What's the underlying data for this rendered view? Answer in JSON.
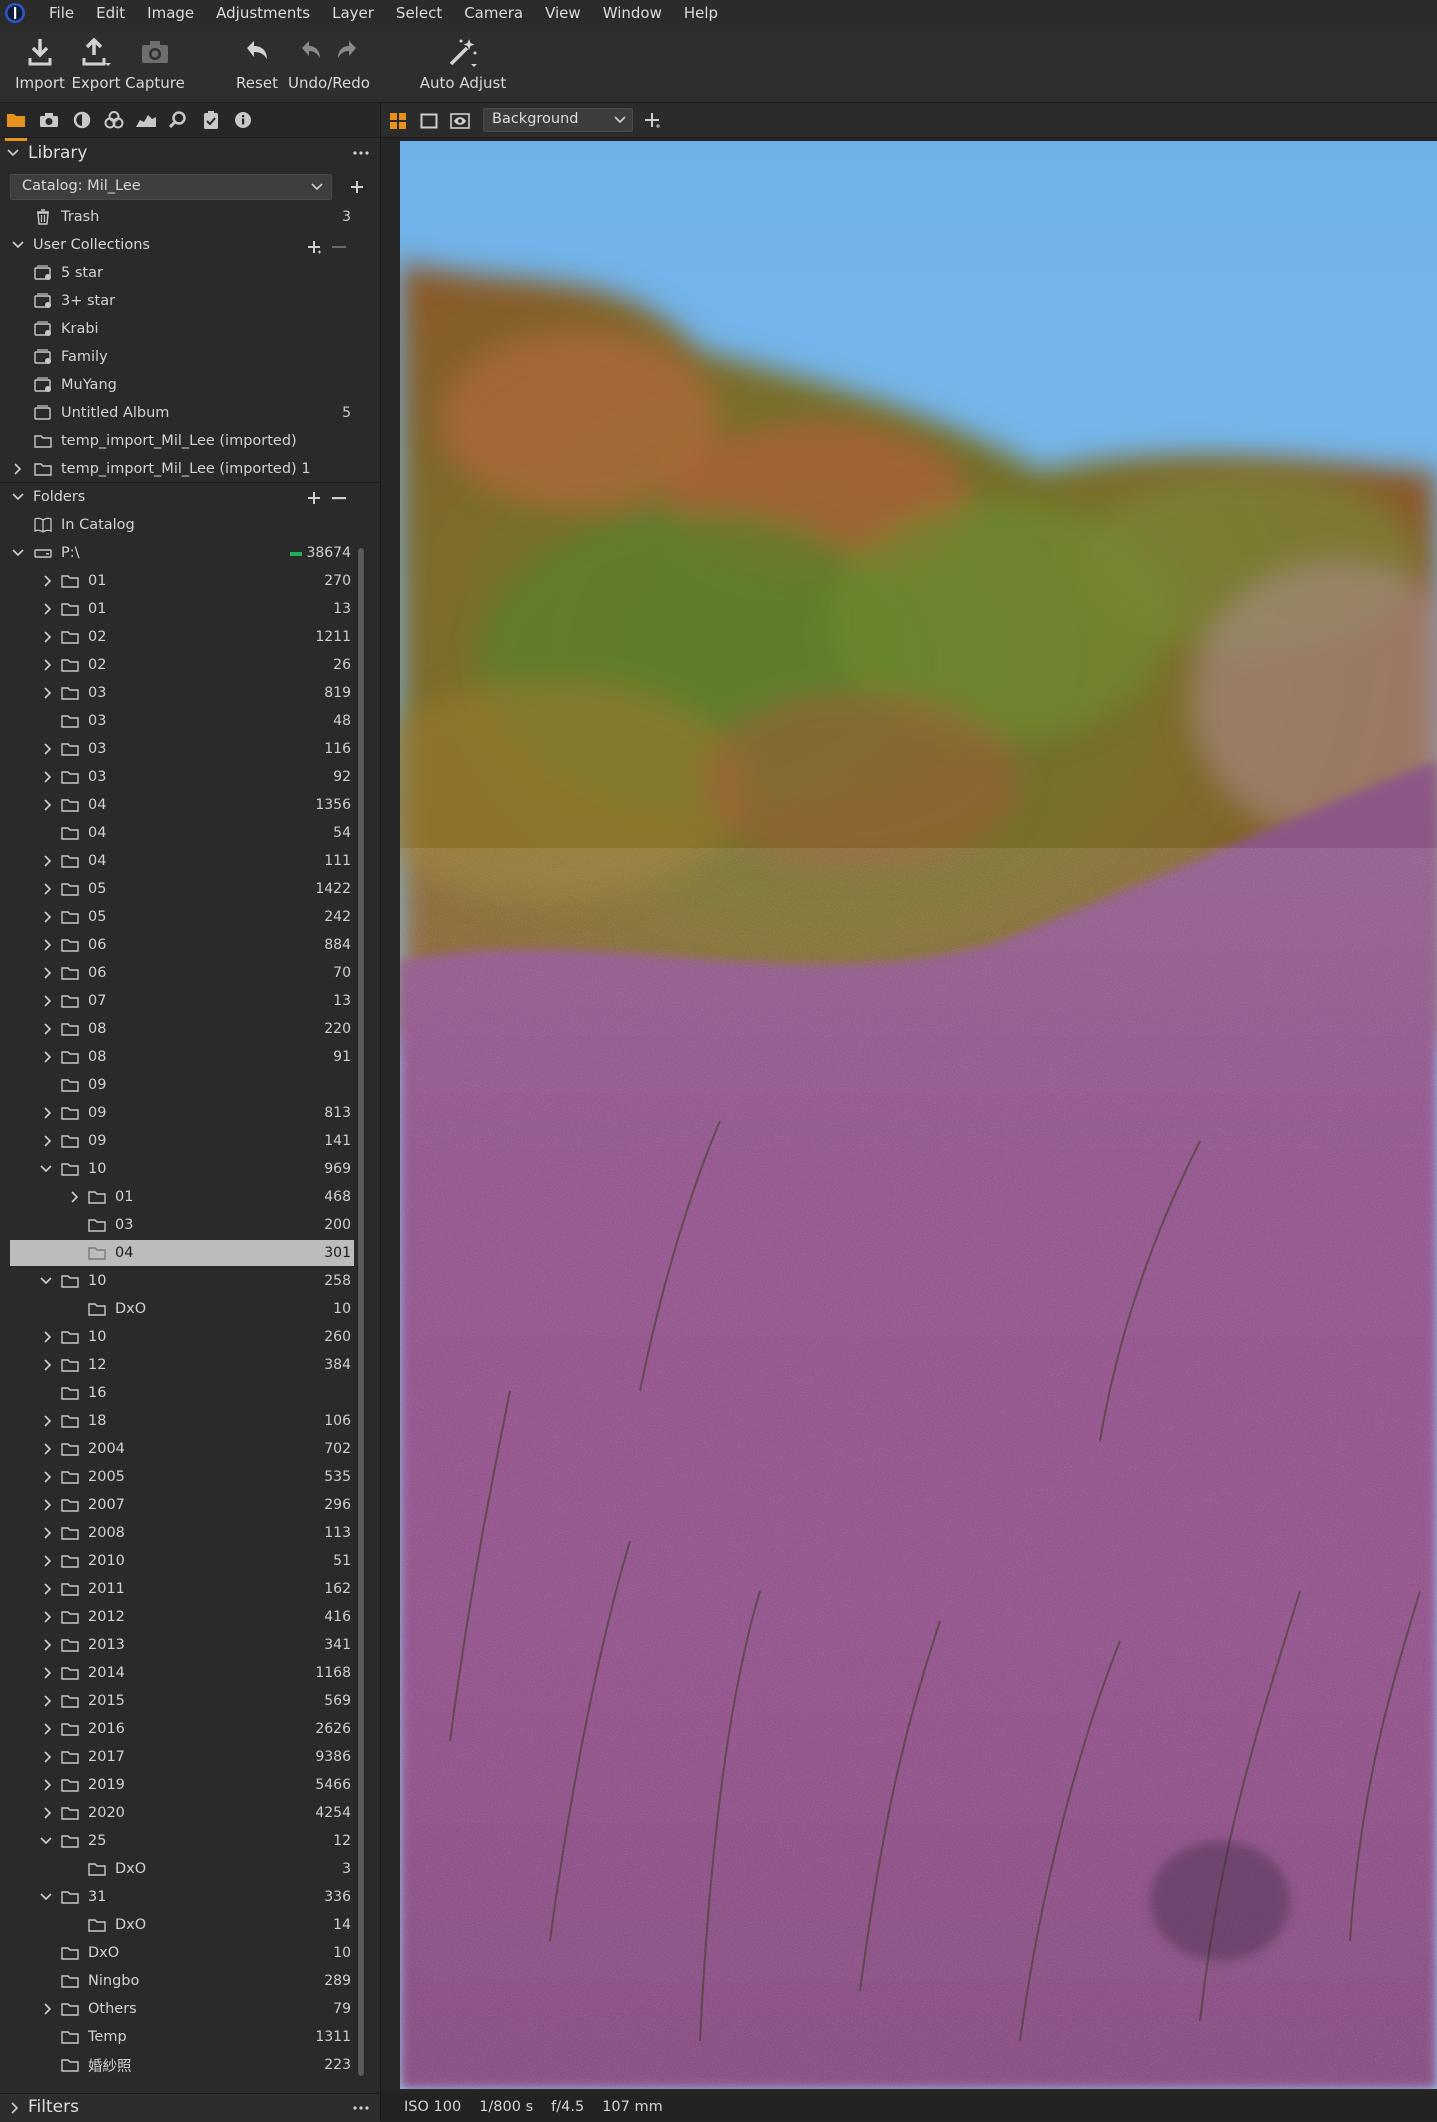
{
  "menu": [
    "File",
    "Edit",
    "Image",
    "Adjustments",
    "Layer",
    "Select",
    "Camera",
    "View",
    "Window",
    "Help"
  ],
  "toolbar": {
    "import": "Import",
    "export": "Export",
    "capture": "Capture",
    "reset": "Reset",
    "undo_redo": "Undo/Redo",
    "auto_adjust": "Auto Adjust"
  },
  "panel_tabs": [
    "folder-icon",
    "camera-icon",
    "circle-icon",
    "color-icon",
    "histogram-icon",
    "search-icon",
    "clipboard-icon",
    "info-icon"
  ],
  "library": {
    "title": "Library",
    "catalog": "Catalog: Mil_Lee",
    "trash_label": "Trash",
    "trash_count": "3"
  },
  "user_collections": {
    "title": "User Collections",
    "items": [
      {
        "label": "5 star",
        "count": ""
      },
      {
        "label": "3+ star",
        "count": ""
      },
      {
        "label": "Krabi",
        "count": ""
      },
      {
        "label": "Family",
        "count": ""
      },
      {
        "label": "MuYang",
        "count": ""
      },
      {
        "label": "Untitled Album",
        "count": "5"
      },
      {
        "label": "temp_import_Mil_Lee (imported)",
        "count": ""
      },
      {
        "label": "temp_import_Mil_Lee (imported) 1",
        "count": ""
      }
    ]
  },
  "folders": {
    "title": "Folders",
    "in_catalog": "In Catalog",
    "drive_label": "P:\\",
    "drive_count": "38674",
    "items": [
      {
        "label": "01",
        "count": "270",
        "level": 1,
        "exp": "c"
      },
      {
        "label": "01",
        "count": "13",
        "level": 1,
        "exp": "c"
      },
      {
        "label": "02",
        "count": "1211",
        "level": 1,
        "exp": "c"
      },
      {
        "label": "02",
        "count": "26",
        "level": 1,
        "exp": "c"
      },
      {
        "label": "03",
        "count": "819",
        "level": 1,
        "exp": "c"
      },
      {
        "label": "03",
        "count": "48",
        "level": 1,
        "exp": ""
      },
      {
        "label": "03",
        "count": "116",
        "level": 1,
        "exp": "c"
      },
      {
        "label": "03",
        "count": "92",
        "level": 1,
        "exp": "c"
      },
      {
        "label": "04",
        "count": "1356",
        "level": 1,
        "exp": "c"
      },
      {
        "label": "04",
        "count": "54",
        "level": 1,
        "exp": ""
      },
      {
        "label": "04",
        "count": "111",
        "level": 1,
        "exp": "c"
      },
      {
        "label": "05",
        "count": "1422",
        "level": 1,
        "exp": "c"
      },
      {
        "label": "05",
        "count": "242",
        "level": 1,
        "exp": "c"
      },
      {
        "label": "06",
        "count": "884",
        "level": 1,
        "exp": "c"
      },
      {
        "label": "06",
        "count": "70",
        "level": 1,
        "exp": "c"
      },
      {
        "label": "07",
        "count": "13",
        "level": 1,
        "exp": "c"
      },
      {
        "label": "08",
        "count": "220",
        "level": 1,
        "exp": "c"
      },
      {
        "label": "08",
        "count": "91",
        "level": 1,
        "exp": "c"
      },
      {
        "label": "09",
        "count": "",
        "level": 1,
        "exp": ""
      },
      {
        "label": "09",
        "count": "813",
        "level": 1,
        "exp": "c"
      },
      {
        "label": "09",
        "count": "141",
        "level": 1,
        "exp": "c"
      },
      {
        "label": "10",
        "count": "969",
        "level": 1,
        "exp": "e"
      },
      {
        "label": "01",
        "count": "468",
        "level": 2,
        "exp": "c"
      },
      {
        "label": "03",
        "count": "200",
        "level": 2,
        "exp": ""
      },
      {
        "label": "04",
        "count": "301",
        "level": 2,
        "exp": "",
        "selected": true
      },
      {
        "label": "10",
        "count": "258",
        "level": 1,
        "exp": "e"
      },
      {
        "label": "DxO",
        "count": "10",
        "level": 2,
        "exp": ""
      },
      {
        "label": "10",
        "count": "260",
        "level": 1,
        "exp": "c"
      },
      {
        "label": "12",
        "count": "384",
        "level": 1,
        "exp": "c"
      },
      {
        "label": "16",
        "count": "",
        "level": 1,
        "exp": ""
      },
      {
        "label": "18",
        "count": "106",
        "level": 1,
        "exp": "c"
      },
      {
        "label": "2004",
        "count": "702",
        "level": 1,
        "exp": "c"
      },
      {
        "label": "2005",
        "count": "535",
        "level": 1,
        "exp": "c"
      },
      {
        "label": "2007",
        "count": "296",
        "level": 1,
        "exp": "c"
      },
      {
        "label": "2008",
        "count": "113",
        "level": 1,
        "exp": "c"
      },
      {
        "label": "2010",
        "count": "51",
        "level": 1,
        "exp": "c"
      },
      {
        "label": "2011",
        "count": "162",
        "level": 1,
        "exp": "c"
      },
      {
        "label": "2012",
        "count": "416",
        "level": 1,
        "exp": "c"
      },
      {
        "label": "2013",
        "count": "341",
        "level": 1,
        "exp": "c"
      },
      {
        "label": "2014",
        "count": "1168",
        "level": 1,
        "exp": "c"
      },
      {
        "label": "2015",
        "count": "569",
        "level": 1,
        "exp": "c"
      },
      {
        "label": "2016",
        "count": "2626",
        "level": 1,
        "exp": "c"
      },
      {
        "label": "2017",
        "count": "9386",
        "level": 1,
        "exp": "c"
      },
      {
        "label": "2019",
        "count": "5466",
        "level": 1,
        "exp": "c"
      },
      {
        "label": "2020",
        "count": "4254",
        "level": 1,
        "exp": "c"
      },
      {
        "label": "25",
        "count": "12",
        "level": 1,
        "exp": "e"
      },
      {
        "label": "DxO",
        "count": "3",
        "level": 2,
        "exp": ""
      },
      {
        "label": "31",
        "count": "336",
        "level": 1,
        "exp": "e"
      },
      {
        "label": "DxO",
        "count": "14",
        "level": 2,
        "exp": ""
      },
      {
        "label": "DxO",
        "count": "10",
        "level": 1,
        "exp": ""
      },
      {
        "label": "Ningbo",
        "count": "289",
        "level": 1,
        "exp": ""
      },
      {
        "label": "Others",
        "count": "79",
        "level": 1,
        "exp": "c"
      },
      {
        "label": "Temp",
        "count": "1311",
        "level": 1,
        "exp": ""
      },
      {
        "label": "婚紗照",
        "count": "223",
        "level": 1,
        "exp": ""
      }
    ]
  },
  "filters": {
    "title": "Filters"
  },
  "viewer": {
    "layer": "Background",
    "exif": {
      "iso": "ISO 100",
      "shutter": "1/800 s",
      "aperture": "f/4.5",
      "focal": "107 mm"
    }
  },
  "colors": {
    "accent": "#e8921d",
    "drive_indicator": "#1fae5b",
    "selection": "#bcbcbc"
  }
}
